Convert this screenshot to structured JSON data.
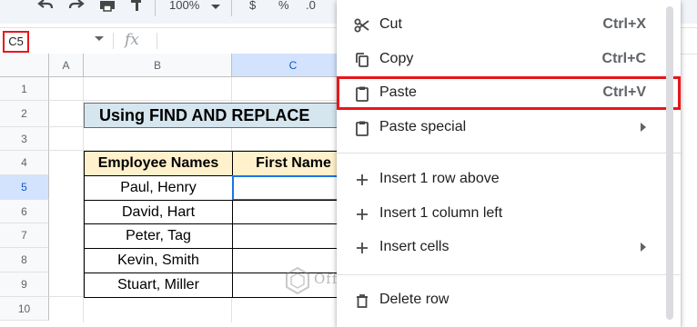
{
  "toolbar": {
    "zoom": "100%",
    "currency": "$",
    "percent": "%",
    "decimal": ".0"
  },
  "formula_bar": {
    "name_box": "C5",
    "fx": "fx"
  },
  "columns": [
    "A",
    "B",
    "C"
  ],
  "rows": [
    "1",
    "2",
    "3",
    "4",
    "5",
    "6",
    "7",
    "8",
    "9",
    "10"
  ],
  "sheet": {
    "title": "Using FIND AND REPLACE",
    "headers": {
      "names": "Employee Names",
      "first": "First Name"
    },
    "names": [
      "Paul, Henry",
      "David, Hart",
      "Peter, Tag",
      "Kevin, Smith",
      "Stuart, Miller"
    ]
  },
  "context_menu": {
    "items": [
      {
        "label": "Cut",
        "shortcut": "Ctrl+X",
        "icon": "scissors-icon"
      },
      {
        "label": "Copy",
        "shortcut": "Ctrl+C",
        "icon": "copy-icon"
      },
      {
        "label": "Paste",
        "shortcut": "Ctrl+V",
        "icon": "clipboard-icon",
        "highlighted": true
      },
      {
        "label": "Paste special",
        "icon": "clipboard-icon",
        "submenu": true
      },
      {
        "label": "Insert 1 row above",
        "icon": "plus-icon"
      },
      {
        "label": "Insert 1 column left",
        "icon": "plus-icon"
      },
      {
        "label": "Insert cells",
        "icon": "plus-icon",
        "submenu": true
      },
      {
        "label": "Delete row",
        "icon": "trash-icon"
      }
    ]
  },
  "watermark": "OfficeWheel",
  "colors": {
    "highlight_red": "#e8161a",
    "selection_blue": "#1a73e8",
    "title_fill": "#d6e6ef",
    "header_fill": "#fff1cc"
  }
}
